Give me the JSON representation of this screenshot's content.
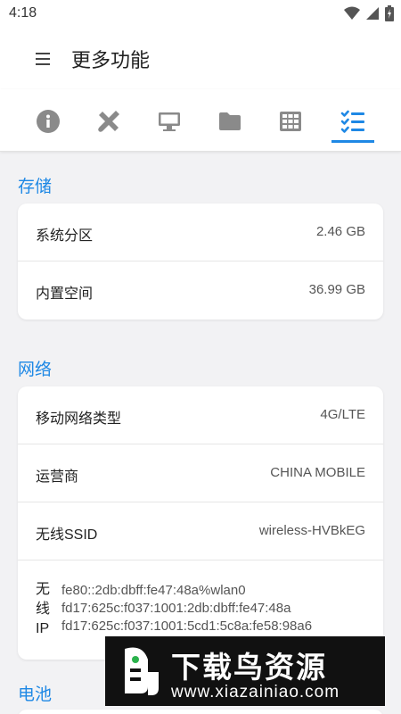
{
  "status_bar": {
    "time": "4:18",
    "icons": [
      "wifi-icon",
      "signal-icon",
      "battery-icon"
    ]
  },
  "app_bar": {
    "title": "更多功能",
    "menu_icon": "menu-icon"
  },
  "tabs": [
    {
      "icon": "info-icon"
    },
    {
      "icon": "tools-icon"
    },
    {
      "icon": "monitor-icon"
    },
    {
      "icon": "folder-icon"
    },
    {
      "icon": "grid-icon"
    },
    {
      "icon": "checklist-icon",
      "active": true
    }
  ],
  "storage": {
    "title": "存储",
    "rows": [
      {
        "label": "系统分区",
        "value": "2.46 GB"
      },
      {
        "label": "内置空间",
        "value": "36.99 GB"
      }
    ]
  },
  "network": {
    "title": "网络",
    "rows": [
      {
        "label": "移动网络类型",
        "value": "4G/LTE"
      },
      {
        "label": "运营商",
        "value": "CHINA MOBILE"
      },
      {
        "label": "无线SSID",
        "value": "wireless-HVBkEG"
      }
    ],
    "ip": {
      "label": [
        "无",
        "线",
        "IP"
      ],
      "values": [
        "fe80::2db:dbff:fe47:48a%wlan0",
        "fd17:625c:f037:1001:2db:dbff:fe47:48a",
        "fd17:625c:f037:1001:5cd1:5c8a:fe58:98a6"
      ]
    }
  },
  "battery": {
    "title": "电池"
  },
  "watermark": {
    "title": "下载鸟资源",
    "url": "www.xiazainiao.com"
  },
  "colors": {
    "accent": "#1e88e5",
    "icon_gray": "#8a8a8a",
    "background": "#f2f2f4"
  }
}
